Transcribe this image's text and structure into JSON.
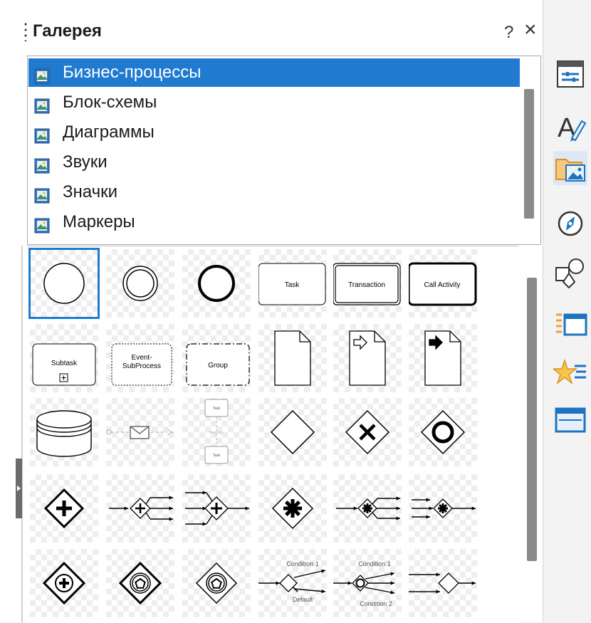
{
  "panel": {
    "title": "Галерея",
    "help_label": "?",
    "close_label": "×"
  },
  "themes": {
    "selected_index": 0,
    "items": [
      {
        "label": "Бизнес-процессы"
      },
      {
        "label": "Блок-схемы"
      },
      {
        "label": "Диаграммы"
      },
      {
        "label": "Звуки"
      },
      {
        "label": "Значки"
      },
      {
        "label": "Маркеры"
      }
    ]
  },
  "gallery": {
    "selected_index": 0,
    "items": [
      {
        "name": "start-event-icon"
      },
      {
        "name": "intermediate-event-icon"
      },
      {
        "name": "end-event-icon"
      },
      {
        "name": "task-shape",
        "text": "Task"
      },
      {
        "name": "transaction-shape",
        "text": "Transaction"
      },
      {
        "name": "call-activity-shape",
        "text": "Call Activity"
      },
      {
        "name": "subtask-shape",
        "text": "Subtask"
      },
      {
        "name": "event-subprocess-shape",
        "text1": "Event-",
        "text2": "SubProcess"
      },
      {
        "name": "group-shape",
        "text": "Group"
      },
      {
        "name": "data-object-icon"
      },
      {
        "name": "data-input-icon"
      },
      {
        "name": "data-output-icon"
      },
      {
        "name": "data-store-icon"
      },
      {
        "name": "message-flow-icon"
      },
      {
        "name": "task-sequence-icon"
      },
      {
        "name": "exclusive-gateway-icon"
      },
      {
        "name": "exclusive-gateway-x-icon"
      },
      {
        "name": "event-gateway-icon"
      },
      {
        "name": "parallel-gateway-icon"
      },
      {
        "name": "parallel-fork-icon"
      },
      {
        "name": "parallel-join-icon"
      },
      {
        "name": "complex-gateway-icon"
      },
      {
        "name": "complex-fork-icon"
      },
      {
        "name": "complex-join-icon"
      },
      {
        "name": "parallel-event-gateway-icon"
      },
      {
        "name": "event-based-gateway-icon"
      },
      {
        "name": "exclusive-event-gateway-icon"
      },
      {
        "name": "conditional-split-icon",
        "cond": "Condition 1",
        "def": "Default"
      },
      {
        "name": "conditional-split-2-icon",
        "cond": "Condition 1",
        "cond2": "Condition 2"
      },
      {
        "name": "converging-gateway-icon"
      }
    ]
  },
  "sidebar_tabs": [
    {
      "name": "properties-tab-icon"
    },
    {
      "name": "styles-tab-icon"
    },
    {
      "name": "gallery-tab-icon"
    },
    {
      "name": "navigator-tab-icon"
    },
    {
      "name": "shapes-tab-icon"
    },
    {
      "name": "page-tab-icon"
    },
    {
      "name": "animation-tab-icon"
    },
    {
      "name": "slide-transition-tab-icon"
    }
  ],
  "colors": {
    "accent": "#1f7ad0",
    "icon_blue": "#1e73be",
    "icon_orange": "#f0a030"
  }
}
